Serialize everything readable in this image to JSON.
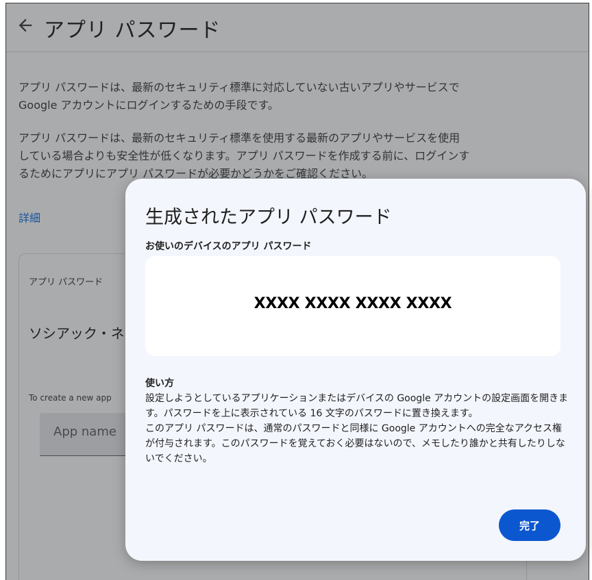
{
  "header": {
    "title": "アプリ パスワード",
    "back_icon": "arrow-left-icon"
  },
  "intro": {
    "paragraph1": "アプリ パスワードは、最新のセキュリティ標準に対応していない古いアプリやサービスで Google アカウントにログインするための手段です。",
    "paragraph2": "アプリ パスワードは、最新のセキュリティ標準を使用する最新のアプリやサービスを使用している場合よりも安全性が低くなります。アプリ パスワードを作成する前に、ログインするためにアプリにアプリ パスワードが必要かどうかをご確認ください。",
    "learn_more": "詳細"
  },
  "card": {
    "label": "アプリ パスワード",
    "existing_name": "ソシアック・ネ",
    "hint": "To create a new app",
    "app_name_placeholder": "App name"
  },
  "dialog": {
    "title": "生成されたアプリ パスワード",
    "password_label": "お使いのデバイスのアプリ パスワード",
    "password_value": "XXXX XXXX XXXX XXXX",
    "usage_heading": "使い方",
    "usage_text": "設定しようとしているアプリケーションまたはデバイスの Google アカウントの設定画面を開きます。パスワードを上に表示されている 16 文字のパスワードに置き換えます。\nこのアプリ パスワードは、通常のパスワードと同様に Google アカウントへの完全なアクセス権が付与されます。このパスワードを覚えておく必要はないので、メモしたり誰かと共有したりしないでください。",
    "done_label": "完了"
  },
  "colors": {
    "accent": "#0b57d0",
    "link": "#1a73e8",
    "dialog_bg": "#f3f6fc"
  }
}
